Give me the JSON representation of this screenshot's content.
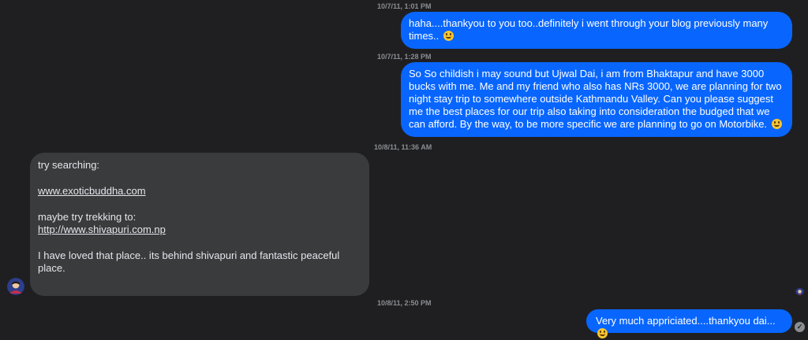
{
  "conversation": {
    "messages": [
      {
        "timestamp": "10/7/11, 1:01 PM",
        "direction": "outgoing",
        "text": "haha....thankyou to you too..definitely i went through your blog previously many times.. ",
        "emoji": "smiley"
      },
      {
        "timestamp": "10/7/11, 1:28 PM",
        "direction": "outgoing",
        "text": "So So childish i may sound but Ujwal Dai, i am from Bhaktapur and have 3000 bucks with me. Me and my friend who also has NRs 3000, we are planning for two night stay trip to somewhere outside Kathmandu Valley. Can you please suggest me the best places for our trip also taking into consideration the budged that we can afford. By the way, to be more specific we are planning to go on Motorbike. ",
        "emoji": "smiley"
      },
      {
        "timestamp": "10/8/11, 11:36 AM",
        "direction": "incoming",
        "line1": "try searching:",
        "link1": "www.exoticbuddha.com",
        "line2": "maybe try trekking to:",
        "link2": "http://www.shivapuri.com.np",
        "line3": "I have loved that place.. its behind shivapuri and fantastic peaceful place."
      },
      {
        "timestamp": "10/8/11, 2:50 PM",
        "direction": "outgoing",
        "text": "Very much appriciated....thankyou dai... ",
        "emoji": "smiley"
      }
    ]
  },
  "colors": {
    "background": "#1f1f22",
    "outgoing_bubble": "#0866ff",
    "incoming_bubble": "#3a3b3d",
    "timestamp": "#8a8d91"
  },
  "icons": {
    "emoji": "smiley-emoji-icon",
    "avatar": "user-avatar",
    "read_receipt": "read-receipt-icon"
  }
}
